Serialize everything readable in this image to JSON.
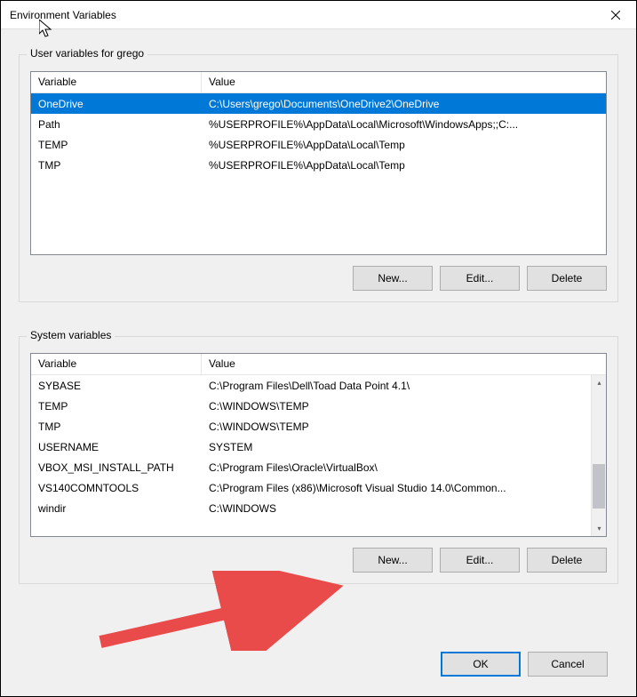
{
  "title": "Environment Variables",
  "user_group_label": "User variables for grego",
  "system_group_label": "System variables",
  "columns": {
    "variable": "Variable",
    "value": "Value"
  },
  "user_rows": [
    {
      "variable": "OneDrive",
      "value": "C:\\Users\\grego\\Documents\\OneDrive2\\OneDrive",
      "selected": true
    },
    {
      "variable": "Path",
      "value": "%USERPROFILE%\\AppData\\Local\\Microsoft\\WindowsApps;;C:...",
      "selected": false
    },
    {
      "variable": "TEMP",
      "value": "%USERPROFILE%\\AppData\\Local\\Temp",
      "selected": false
    },
    {
      "variable": "TMP",
      "value": "%USERPROFILE%\\AppData\\Local\\Temp",
      "selected": false
    }
  ],
  "system_rows": [
    {
      "variable": "SYBASE",
      "value": "C:\\Program Files\\Dell\\Toad Data Point 4.1\\"
    },
    {
      "variable": "TEMP",
      "value": "C:\\WINDOWS\\TEMP"
    },
    {
      "variable": "TMP",
      "value": "C:\\WINDOWS\\TEMP"
    },
    {
      "variable": "USERNAME",
      "value": "SYSTEM"
    },
    {
      "variable": "VBOX_MSI_INSTALL_PATH",
      "value": "C:\\Program Files\\Oracle\\VirtualBox\\"
    },
    {
      "variable": "VS140COMNTOOLS",
      "value": "C:\\Program Files (x86)\\Microsoft Visual Studio 14.0\\Common..."
    },
    {
      "variable": "windir",
      "value": "C:\\WINDOWS"
    }
  ],
  "buttons": {
    "new": "New...",
    "edit": "Edit...",
    "delete": "Delete",
    "ok": "OK",
    "cancel": "Cancel"
  }
}
